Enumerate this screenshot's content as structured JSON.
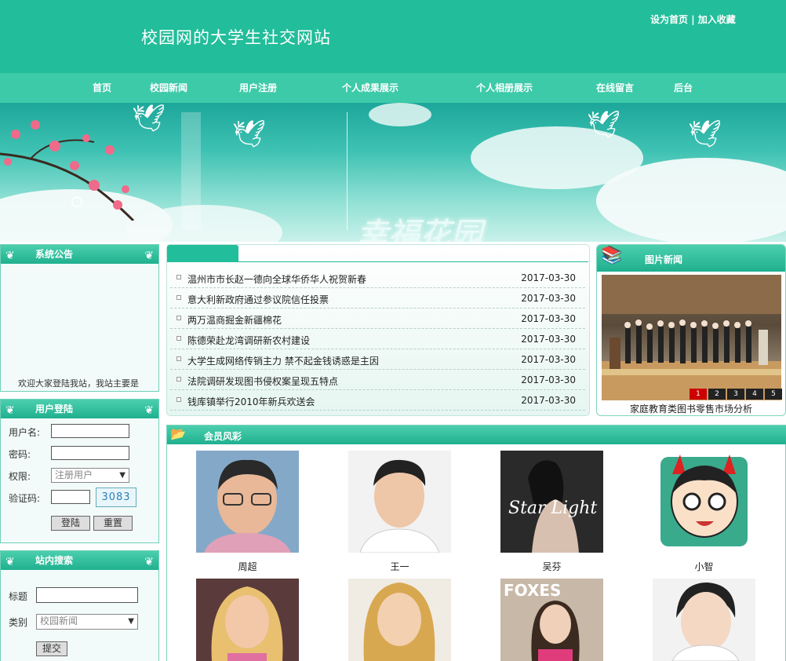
{
  "header": {
    "site_title": "校园网的大学生社交网站",
    "set_home": "设为首页",
    "separator": "|",
    "add_favorite": "加入收藏"
  },
  "nav": {
    "items": [
      "首页",
      "校园新闻",
      "用户注册",
      "个人成果展示",
      "个人相册展示",
      "在线留言",
      "后台"
    ]
  },
  "banner": {
    "text": "幸福花园"
  },
  "announcement": {
    "title": "系统公告",
    "ticker": "欢迎大家登陆我站，我站主要是"
  },
  "login": {
    "title": "用户登陆",
    "username_label": "用户名:",
    "password_label": "密码:",
    "role_label": "权限:",
    "role_selected": "注册用户",
    "captcha_label": "验证码:",
    "captcha_code": "3083",
    "login_button": "登陆",
    "reset_button": "重置"
  },
  "search": {
    "title": "站内搜索",
    "title_label": "标题",
    "category_label": "类别",
    "category_selected": "校园新闻",
    "submit_button": "提交"
  },
  "news": {
    "items": [
      {
        "title": "温州市市长赵一德向全球华侨华人祝贺新春",
        "date": "2017-03-30"
      },
      {
        "title": "意大利新政府通过参议院信任投票",
        "date": "2017-03-30"
      },
      {
        "title": "两万温商掘金新疆棉花",
        "date": "2017-03-30"
      },
      {
        "title": "陈德荣赴龙湾调研新农村建设",
        "date": "2017-03-30"
      },
      {
        "title": "大学生成网络传销主力 禁不起金钱诱惑是主因",
        "date": "2017-03-30"
      },
      {
        "title": "法院调研发现图书侵权案呈现五特点",
        "date": "2017-03-30"
      },
      {
        "title": "钱库镇举行2010年新兵欢送会",
        "date": "2017-03-30"
      }
    ]
  },
  "picture_news": {
    "title": "图片新闻",
    "caption": "家庭教育类图书零售市场分析",
    "pages": [
      "1",
      "2",
      "3",
      "4",
      "5"
    ],
    "active_page": "1"
  },
  "members": {
    "title": "会员风彩",
    "list": [
      {
        "name": "周超"
      },
      {
        "name": "王一"
      },
      {
        "name": "吴芬"
      },
      {
        "name": "小智"
      },
      {
        "name": ""
      },
      {
        "name": ""
      },
      {
        "name": ""
      },
      {
        "name": ""
      }
    ],
    "foxes_text": "FOXES",
    "starlight_text": "Star Light"
  },
  "colors": {
    "primary": "#22bd9a",
    "nav": "#3dcaa9",
    "pager_active": "#cc0000"
  }
}
